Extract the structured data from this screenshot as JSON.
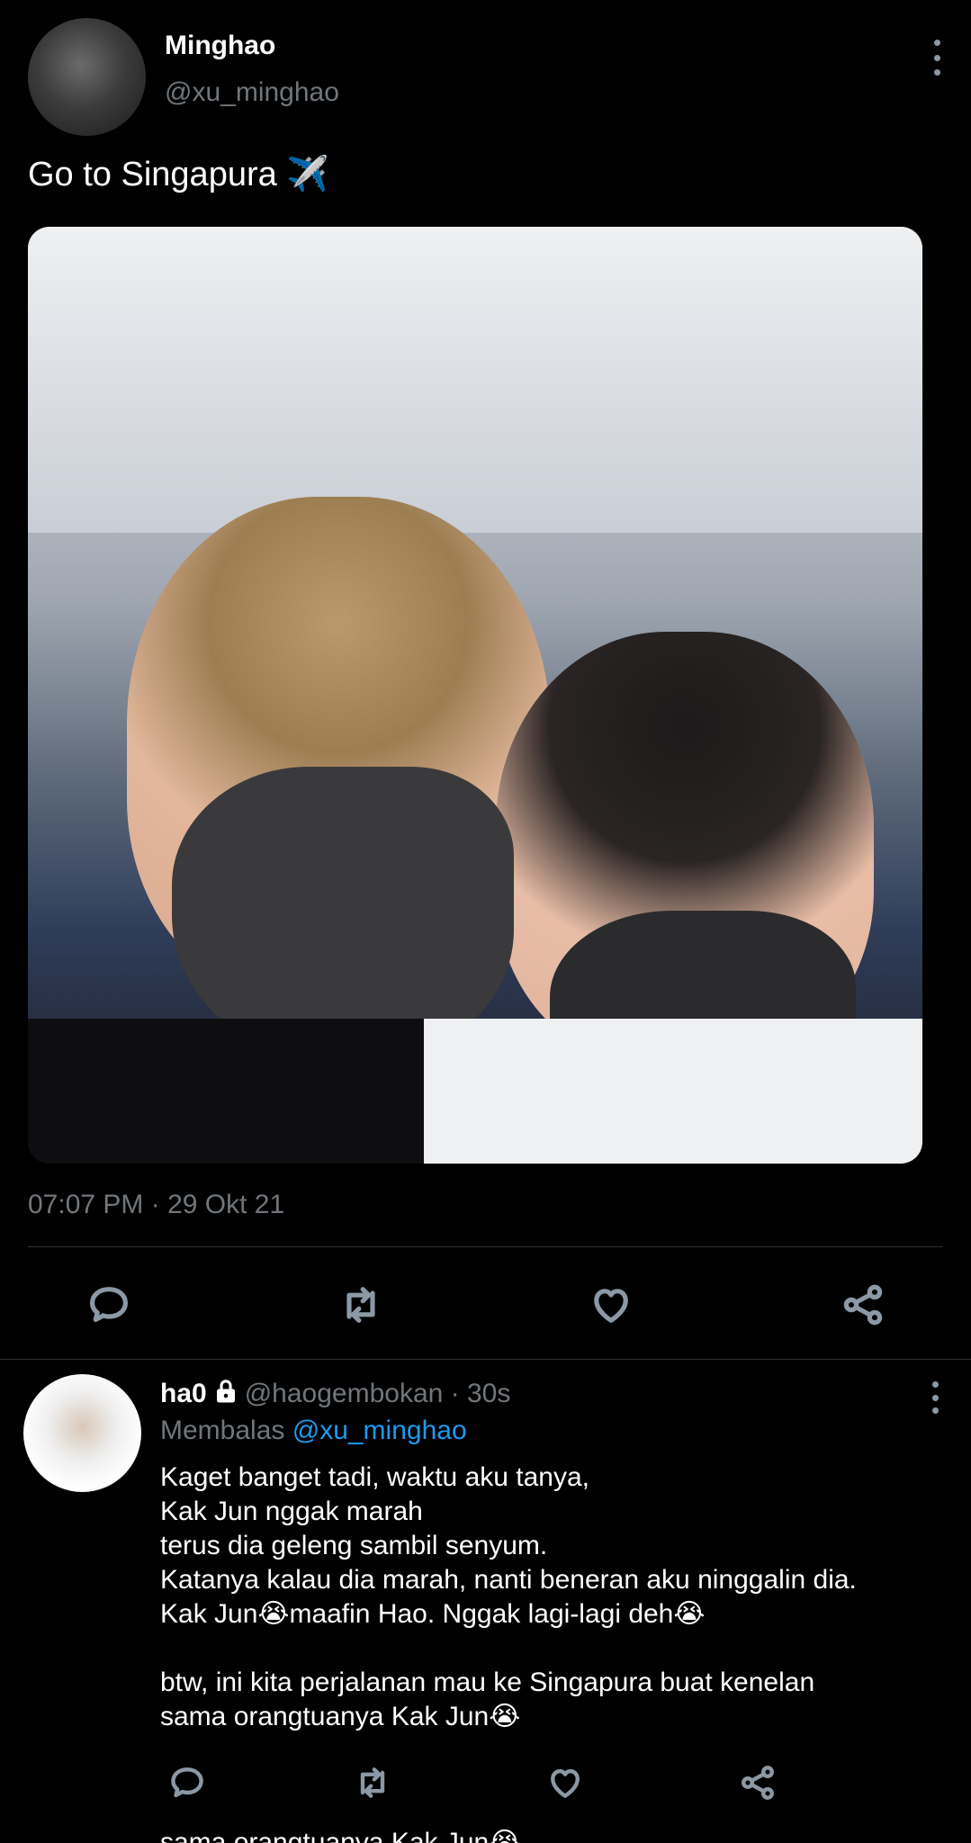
{
  "tweet": {
    "author_name": "Minghao",
    "author_handle": "@xu_minghao",
    "text": "Go to Singapura ✈️",
    "timestamp": "07:07 PM · 29 Okt 21"
  },
  "icons": {
    "more": "more-vertical-icon",
    "reply": "comment-icon",
    "retweet": "retweet-icon",
    "like": "heart-icon",
    "share": "share-icon",
    "lock": "lock-icon"
  },
  "reply": {
    "name": "ha0",
    "handle_time": "@haogembokan · 30s",
    "replying_label": "Membalas",
    "replying_to": "@xu_minghao",
    "lines": [
      "Kaget banget tadi, waktu aku tanya,",
      "Kak Jun nggak marah",
      "terus dia geleng sambil senyum.",
      "Katanya kalau dia marah, nanti beneran aku ninggalin dia.",
      "Kak Jun😭maafin Hao. Nggak lagi-lagi deh😭",
      "",
      "btw, ini kita perjalanan mau ke Singapura buat kenelan",
      "sama orangtuanya Kak Jun😭"
    ]
  },
  "peek": {
    "text": "sama orangtuanya Kak Jun😭"
  },
  "colors": {
    "background": "#000000",
    "text_primary": "#ffffff",
    "text_secondary": "#71767b",
    "link": "#1d9bf0",
    "divider": "#2f3336"
  }
}
